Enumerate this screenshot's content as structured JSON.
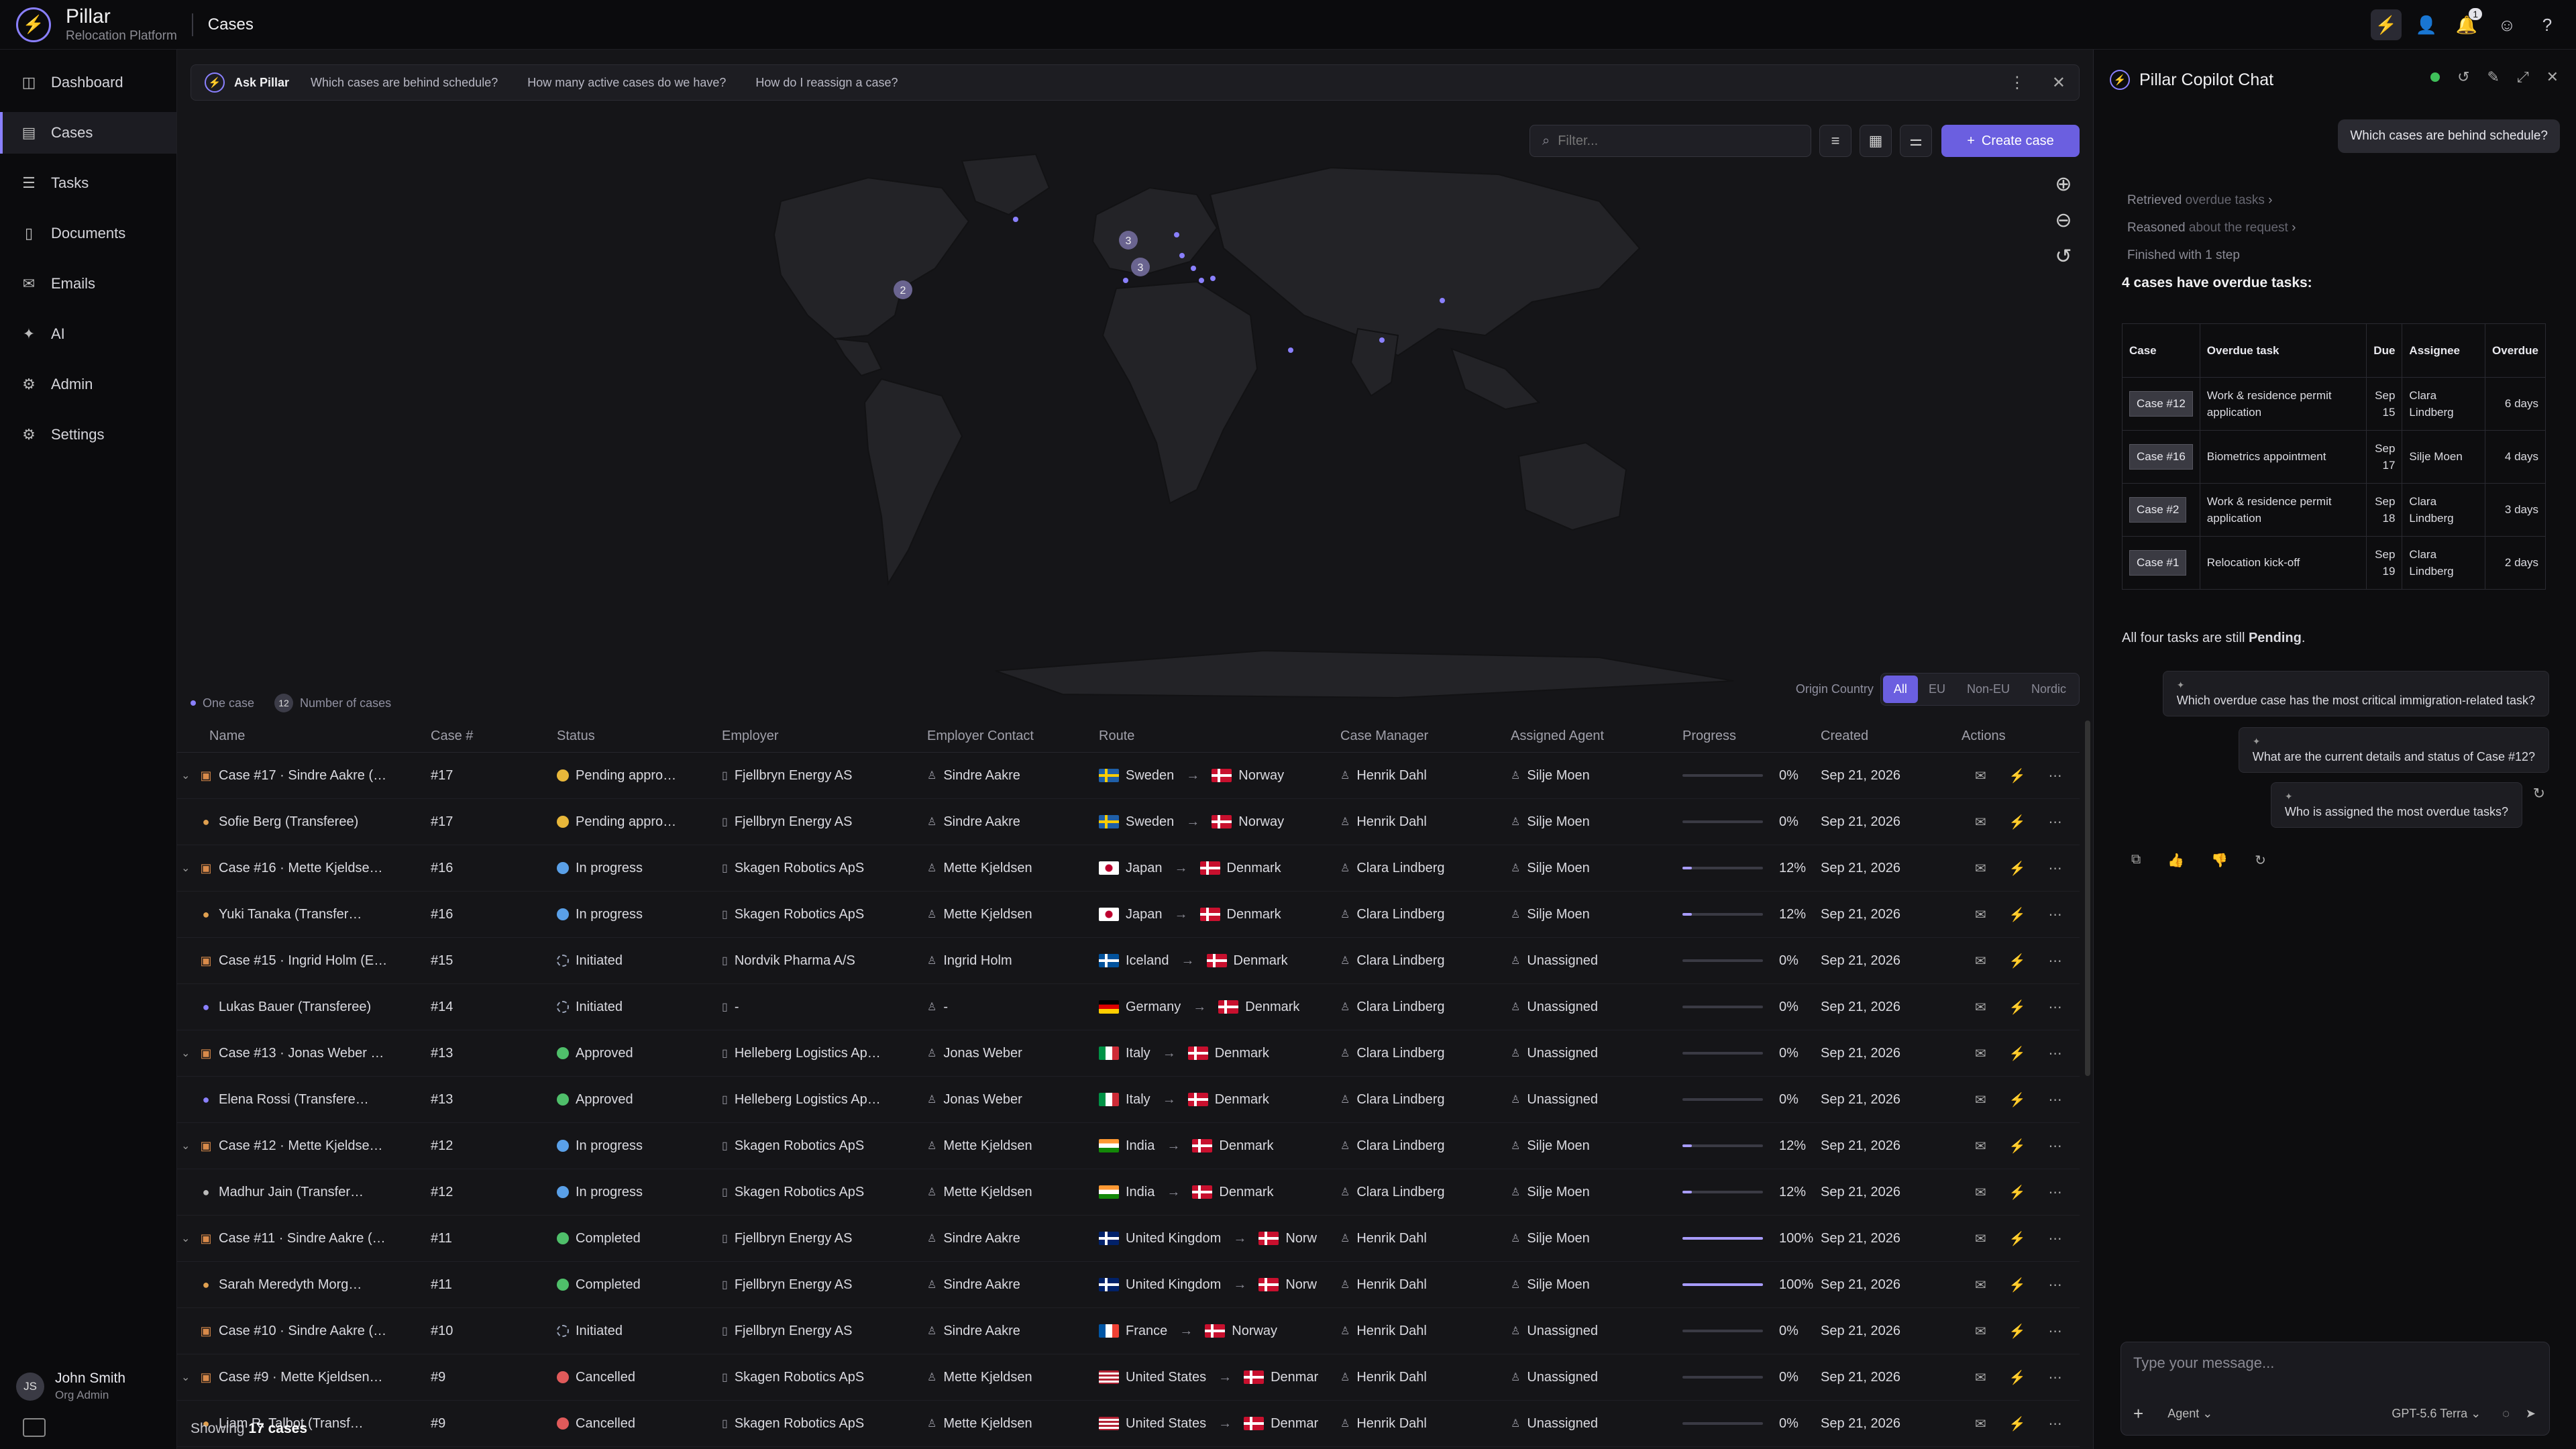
{
  "app": {
    "name": "Pillar",
    "subtitle": "Relocation Platform",
    "page": "Cases",
    "notif_count": "1"
  },
  "sidebar": {
    "items": [
      {
        "label": "Dashboard",
        "icon": "dashboard-icon",
        "glyph": "◫"
      },
      {
        "label": "Cases",
        "icon": "briefcase-icon",
        "glyph": "▤",
        "active": true
      },
      {
        "label": "Tasks",
        "icon": "checklist-icon",
        "glyph": "☰"
      },
      {
        "label": "Documents",
        "icon": "document-icon",
        "glyph": "▯"
      },
      {
        "label": "Emails",
        "icon": "mail-icon",
        "glyph": "✉"
      },
      {
        "label": "AI",
        "icon": "sparkle-icon",
        "glyph": "✦"
      },
      {
        "label": "Admin",
        "icon": "admin-icon",
        "glyph": "⚙"
      },
      {
        "label": "Settings",
        "icon": "gear-icon",
        "glyph": "⚙"
      }
    ],
    "user": {
      "initials": "JS",
      "name": "John Smith",
      "role": "Org Admin"
    }
  },
  "ask": {
    "label": "Ask Pillar",
    "suggestions": [
      "Which cases are behind schedule?",
      "How many active cases do we have?",
      "How do I reassign a case?"
    ]
  },
  "toolbar": {
    "filter_placeholder": "Filter...",
    "create_label": "Create case"
  },
  "map": {
    "legend_one": "One case",
    "legend_badge": "12",
    "legend_many": "Number of cases",
    "origin_label": "Origin Country",
    "origin_options": [
      "All",
      "EU",
      "Non-EU",
      "Nordic"
    ],
    "origin_selected": "All",
    "clusters": [
      "3",
      "3",
      "2"
    ]
  },
  "table": {
    "headers": [
      "Name",
      "Case #",
      "Status",
      "Employer",
      "Employer Contact",
      "Route",
      "Case Manager",
      "Assigned Agent",
      "Progress",
      "Created",
      "Actions"
    ],
    "rows": [
      {
        "expand": true,
        "kind": "case",
        "name": "Case #17 · Sindre Aakre (…",
        "num": "#17",
        "status": "Pending appro…",
        "st": "pending",
        "employer": "Fjellbryn Energy AS",
        "contact": "Sindre Aakre",
        "from": "Sweden",
        "ff": "se",
        "to": "Norway",
        "tf": "no",
        "manager": "Henrik Dahl",
        "agent": "Silje Moen",
        "progress": 0,
        "progress_label": "0%",
        "created": "Sep 21, 2026"
      },
      {
        "expand": false,
        "kind": "person",
        "name": "Sofie Berg (Transferee)",
        "num": "#17",
        "status": "Pending appro…",
        "st": "pending",
        "employer": "Fjellbryn Energy AS",
        "contact": "Sindre Aakre",
        "from": "Sweden",
        "ff": "se",
        "to": "Norway",
        "tf": "no",
        "manager": "Henrik Dahl",
        "agent": "Silje Moen",
        "progress": 0,
        "progress_label": "0%",
        "created": "Sep 21, 2026"
      },
      {
        "expand": true,
        "kind": "case",
        "name": "Case #16 · Mette Kjeldse…",
        "num": "#16",
        "status": "In progress",
        "st": "progress",
        "employer": "Skagen Robotics ApS",
        "contact": "Mette Kjeldsen",
        "from": "Japan",
        "ff": "jp",
        "to": "Denmark",
        "tf": "dk",
        "manager": "Clara Lindberg",
        "agent": "Silje Moen",
        "progress": 12,
        "progress_label": "12%",
        "created": "Sep 21, 2026"
      },
      {
        "expand": false,
        "kind": "person",
        "name": "Yuki Tanaka (Transfer…",
        "num": "#16",
        "status": "In progress",
        "st": "progress",
        "employer": "Skagen Robotics ApS",
        "contact": "Mette Kjeldsen",
        "from": "Japan",
        "ff": "jp",
        "to": "Denmark",
        "tf": "dk",
        "manager": "Clara Lindberg",
        "agent": "Silje Moen",
        "progress": 12,
        "progress_label": "12%",
        "created": "Sep 21, 2026"
      },
      {
        "expand": false,
        "kind": "case",
        "name": "Case #15 · Ingrid Holm (E…",
        "num": "#15",
        "status": "Initiated",
        "st": "initiated",
        "employer": "Nordvik Pharma A/S",
        "contact": "Ingrid Holm",
        "from": "Iceland",
        "ff": "is",
        "to": "Denmark",
        "tf": "dk",
        "manager": "Clara Lindberg",
        "agent": "Unassigned",
        "progress": 0,
        "progress_label": "0%",
        "created": "Sep 21, 2026"
      },
      {
        "expand": false,
        "kind": "person",
        "name": "Lukas Bauer (Transferee)",
        "num": "#14",
        "status": "Initiated",
        "st": "initiated",
        "employer": "-",
        "contact": "-",
        "from": "Germany",
        "ff": "de",
        "to": "Denmark",
        "tf": "dk",
        "manager": "Clara Lindberg",
        "agent": "Unassigned",
        "progress": 0,
        "progress_label": "0%",
        "created": "Sep 21, 2026"
      },
      {
        "expand": true,
        "kind": "case",
        "name": "Case #13 · Jonas Weber …",
        "num": "#13",
        "status": "Approved",
        "st": "approved",
        "employer": "Helleberg Logistics Ap…",
        "contact": "Jonas Weber",
        "from": "Italy",
        "ff": "it",
        "to": "Denmark",
        "tf": "dk",
        "manager": "Clara Lindberg",
        "agent": "Unassigned",
        "progress": 0,
        "progress_label": "0%",
        "created": "Sep 21, 2026"
      },
      {
        "expand": false,
        "kind": "person",
        "name": "Elena Rossi (Transfere…",
        "num": "#13",
        "status": "Approved",
        "st": "approved",
        "employer": "Helleberg Logistics Ap…",
        "contact": "Jonas Weber",
        "from": "Italy",
        "ff": "it",
        "to": "Denmark",
        "tf": "dk",
        "manager": "Clara Lindberg",
        "agent": "Unassigned",
        "progress": 0,
        "progress_label": "0%",
        "created": "Sep 21, 2026"
      },
      {
        "expand": true,
        "kind": "case",
        "name": "Case #12 · Mette Kjeldse…",
        "num": "#12",
        "status": "In progress",
        "st": "progress",
        "employer": "Skagen Robotics ApS",
        "contact": "Mette Kjeldsen",
        "from": "India",
        "ff": "in",
        "to": "Denmark",
        "tf": "dk",
        "manager": "Clara Lindberg",
        "agent": "Silje Moen",
        "progress": 12,
        "progress_label": "12%",
        "created": "Sep 21, 2026"
      },
      {
        "expand": false,
        "kind": "person",
        "name": "Madhur Jain (Transfer…",
        "num": "#12",
        "status": "In progress",
        "st": "progress",
        "employer": "Skagen Robotics ApS",
        "contact": "Mette Kjeldsen",
        "from": "India",
        "ff": "in",
        "to": "Denmark",
        "tf": "dk",
        "manager": "Clara Lindberg",
        "agent": "Silje Moen",
        "progress": 12,
        "progress_label": "12%",
        "created": "Sep 21, 2026"
      },
      {
        "expand": true,
        "kind": "case",
        "name": "Case #11 · Sindre Aakre (…",
        "num": "#11",
        "status": "Completed",
        "st": "completed",
        "employer": "Fjellbryn Energy AS",
        "contact": "Sindre Aakre",
        "from": "United Kingdom",
        "ff": "gb",
        "to": "Norw",
        "tf": "no",
        "manager": "Henrik Dahl",
        "agent": "Silje Moen",
        "progress": 100,
        "progress_label": "100%",
        "created": "Sep 21, 2026"
      },
      {
        "expand": false,
        "kind": "person",
        "name": "Sarah Meredyth Morg…",
        "num": "#11",
        "status": "Completed",
        "st": "completed",
        "employer": "Fjellbryn Energy AS",
        "contact": "Sindre Aakre",
        "from": "United Kingdom",
        "ff": "gb",
        "to": "Norw",
        "tf": "no",
        "manager": "Henrik Dahl",
        "agent": "Silje Moen",
        "progress": 100,
        "progress_label": "100%",
        "created": "Sep 21, 2026"
      },
      {
        "expand": false,
        "kind": "case",
        "name": "Case #10 · Sindre Aakre (…",
        "num": "#10",
        "status": "Initiated",
        "st": "initiated",
        "employer": "Fjellbryn Energy AS",
        "contact": "Sindre Aakre",
        "from": "France",
        "ff": "fr",
        "to": "Norway",
        "tf": "no",
        "manager": "Henrik Dahl",
        "agent": "Unassigned",
        "progress": 0,
        "progress_label": "0%",
        "created": "Sep 21, 2026"
      },
      {
        "expand": true,
        "kind": "case",
        "name": "Case #9 · Mette Kjeldsen…",
        "num": "#9",
        "status": "Cancelled",
        "st": "cancelled",
        "employer": "Skagen Robotics ApS",
        "contact": "Mette Kjeldsen",
        "from": "United States",
        "ff": "us",
        "to": "Denmar",
        "tf": "dk",
        "manager": "Henrik Dahl",
        "agent": "Unassigned",
        "progress": 0,
        "progress_label": "0%",
        "created": "Sep 21, 2026"
      },
      {
        "expand": false,
        "kind": "person",
        "name": "Liam R. Talbot (Transf…",
        "num": "#9",
        "status": "Cancelled",
        "st": "cancelled",
        "employer": "Skagen Robotics ApS",
        "contact": "Mette Kjeldsen",
        "from": "United States",
        "ff": "us",
        "to": "Denmar",
        "tf": "dk",
        "manager": "Henrik Dahl",
        "agent": "Unassigned",
        "progress": 0,
        "progress_label": "0%",
        "created": "Sep 21, 2026"
      }
    ],
    "footer_prefix": "Showing",
    "footer_count": "17 cases"
  },
  "colors": {
    "accent": "#6b5fe0",
    "accent_light": "#a89cff",
    "background": "#151518"
  },
  "chat": {
    "title": "Pillar Copilot Chat",
    "user_msg": "Which cases are behind schedule?",
    "steps": [
      {
        "a": "Retrieved",
        "b": "overdue tasks"
      },
      {
        "a": "Reasoned",
        "b": "about the request"
      },
      {
        "a": "Finished with 1 step",
        "b": ""
      }
    ],
    "answer_title": "4 cases have overdue tasks:",
    "table_headers": [
      "Case",
      "Overdue task",
      "Due",
      "Assignee",
      "Overdue"
    ],
    "table_rows": [
      {
        "case": "Case #12",
        "task": "Work & residence permit application",
        "due": "Sep 15",
        "assignee": "Clara Lindberg",
        "overdue": "6 days"
      },
      {
        "case": "Case #16",
        "task": "Biometrics appointment",
        "due": "Sep 17",
        "assignee": "Silje Moen",
        "overdue": "4 days"
      },
      {
        "case": "Case #2",
        "task": "Work & residence permit application",
        "due": "Sep 18",
        "assignee": "Clara Lindberg",
        "overdue": "3 days"
      },
      {
        "case": "Case #1",
        "task": "Relocation kick-off",
        "due": "Sep 19",
        "assignee": "Clara Lindberg",
        "overdue": "2 days"
      }
    ],
    "still_prefix": "All four tasks are still",
    "still_bold": "Pending",
    "still_suffix": ".",
    "suggestions": [
      "Which overdue case has the most critical immigration-related task?",
      "What are the current details and status of Case #12?",
      "Who is assigned the most overdue tasks?"
    ],
    "input_placeholder": "Type your message...",
    "mode": "Agent",
    "model": "GPT-5.6 Terra"
  }
}
